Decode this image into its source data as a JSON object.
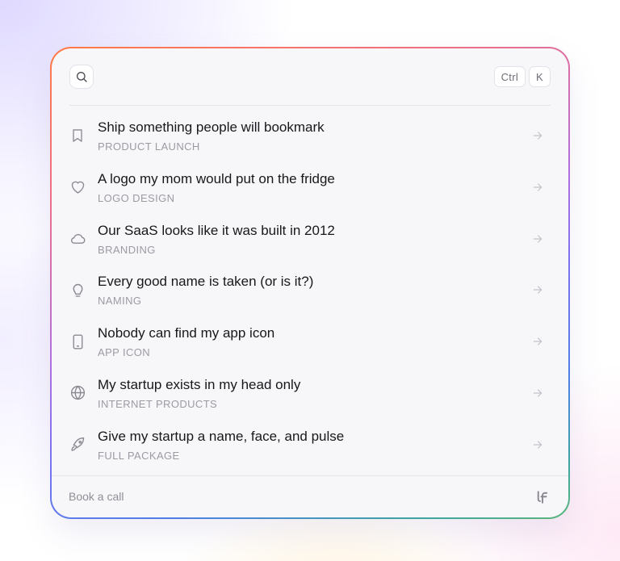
{
  "colors": {
    "title": "#18181c",
    "subtitle": "#9b9ba3",
    "icon": "#8a8a93",
    "arrow": "#c2c2c9",
    "card": "#f7f7fa"
  },
  "search": {
    "icon": "search-icon"
  },
  "shortcut": {
    "keys": [
      "Ctrl",
      "K"
    ]
  },
  "items": [
    {
      "title": "Ship something people will bookmark",
      "subtitle": "PRODUCT LAUNCH",
      "icon": "bookmark-icon"
    },
    {
      "title": "A logo my mom would put on the fridge",
      "subtitle": "LOGO DESIGN",
      "icon": "heart-icon"
    },
    {
      "title": "Our SaaS looks like it was built in 2012",
      "subtitle": "BRANDING",
      "icon": "cloud-icon"
    },
    {
      "title": "Every good name is taken (or is it?)",
      "subtitle": "NAMING",
      "icon": "lightbulb-icon"
    },
    {
      "title": "Nobody can find my app icon",
      "subtitle": "APP ICON",
      "icon": "smartphone-icon"
    },
    {
      "title": "My startup exists in my head only",
      "subtitle": "INTERNET PRODUCTS",
      "icon": "globe-icon"
    },
    {
      "title": "Give my startup a name, face, and pulse",
      "subtitle": "FULL PACKAGE",
      "icon": "rocket-icon"
    }
  ],
  "footer": {
    "link_label": "Book a call",
    "logo_icon": "brand-logo-icon"
  }
}
